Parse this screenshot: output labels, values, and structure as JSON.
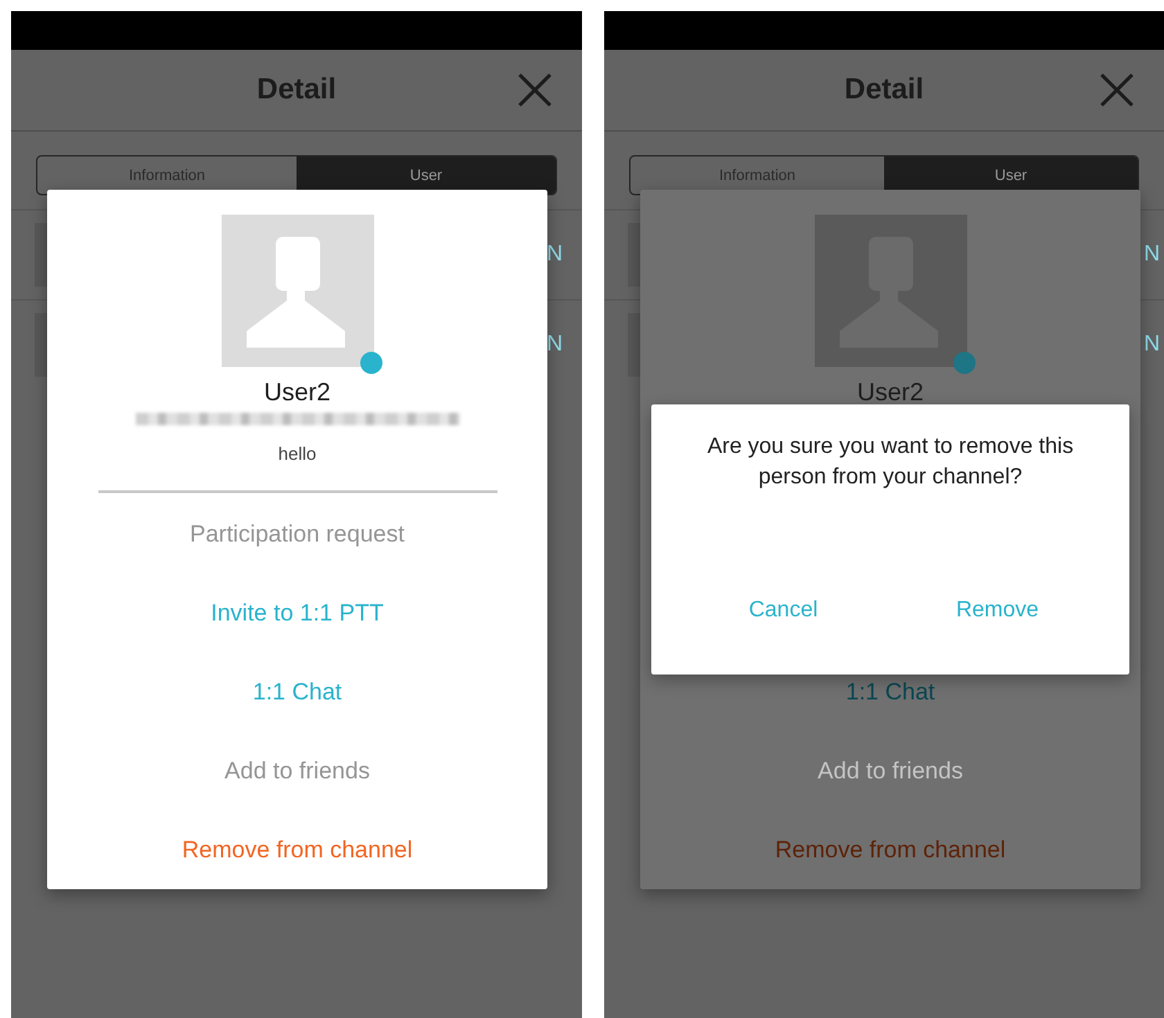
{
  "screens": [
    {
      "header": {
        "title": "Detail"
      },
      "tabs": [
        {
          "label": "Information",
          "selected": false
        },
        {
          "label": "User",
          "selected": true
        }
      ],
      "rows": [
        {
          "action": "N"
        },
        {
          "action": "N"
        }
      ],
      "user_dialog": {
        "dimmed": false,
        "online": true,
        "name": "User2",
        "status": "hello",
        "actions": [
          {
            "label": "Participation request",
            "kind": "disabled"
          },
          {
            "label": "Invite to 1:1 PTT",
            "kind": "enabled"
          },
          {
            "label": "1:1 Chat",
            "kind": "enabled"
          },
          {
            "label": "Add to friends",
            "kind": "disabled"
          },
          {
            "label": "Remove from channel",
            "kind": "destructive"
          }
        ]
      }
    },
    {
      "header": {
        "title": "Detail"
      },
      "tabs": [
        {
          "label": "Information",
          "selected": false
        },
        {
          "label": "User",
          "selected": true
        }
      ],
      "rows": [
        {
          "action": "N"
        },
        {
          "action": "N"
        }
      ],
      "user_dialog": {
        "dimmed": true,
        "online": true,
        "name": "User2",
        "actions": [
          {
            "label": "1:1 Chat",
            "kind": "enabled"
          },
          {
            "label": "Add to friends",
            "kind": "disabled"
          },
          {
            "label": "Remove from channel",
            "kind": "destructive"
          }
        ]
      },
      "confirm_dialog": {
        "message": "Are you sure you want to remove this person from your channel?",
        "buttons": [
          "Cancel",
          "Remove"
        ]
      }
    }
  ]
}
